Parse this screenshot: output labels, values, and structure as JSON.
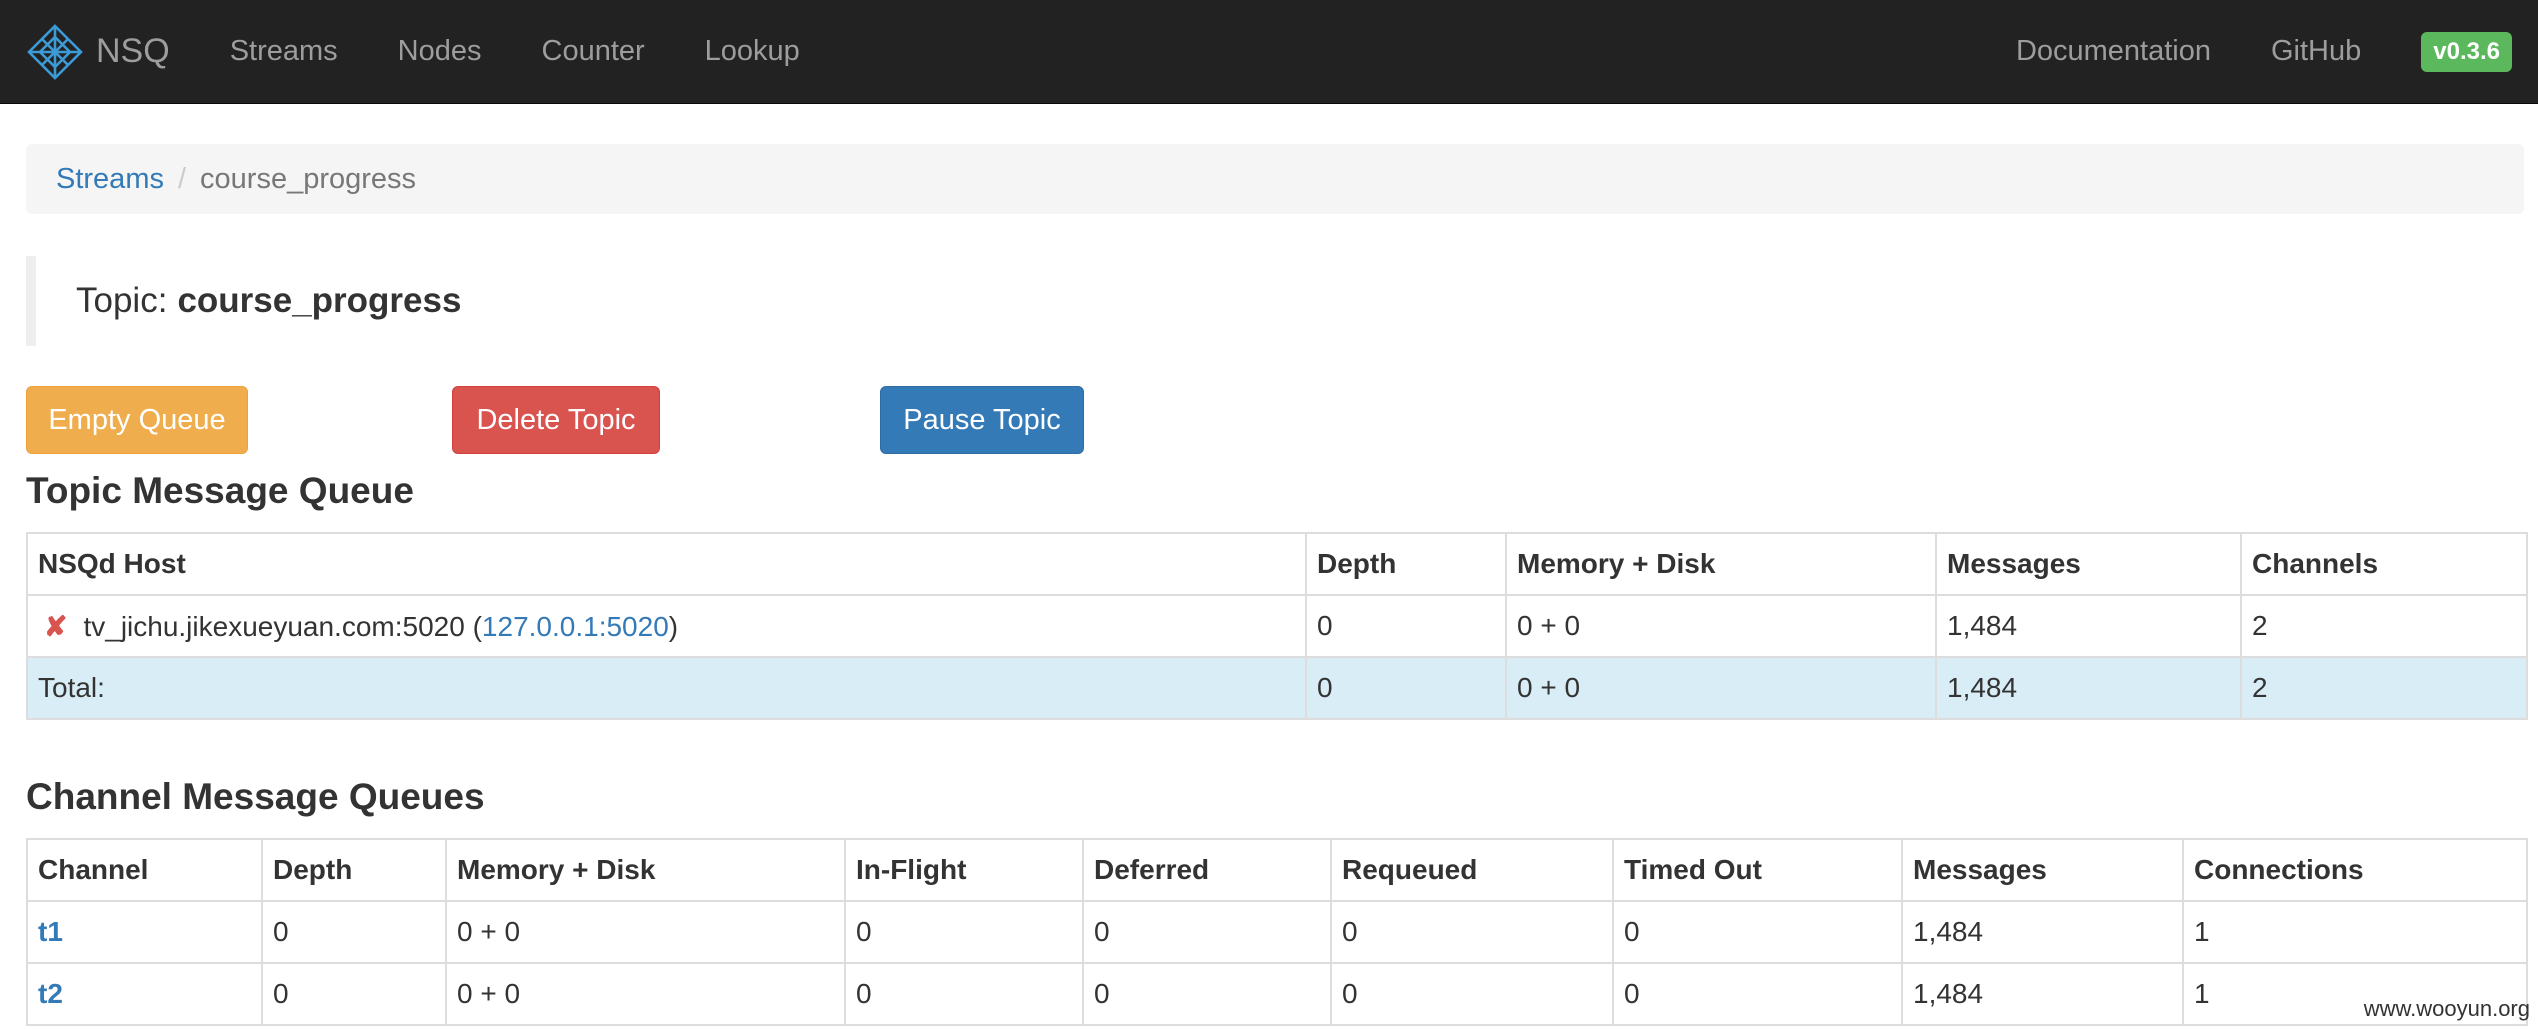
{
  "navbar": {
    "brand": "NSQ",
    "links": [
      "Streams",
      "Nodes",
      "Counter",
      "Lookup"
    ],
    "right_links": [
      "Documentation",
      "GitHub"
    ],
    "version": "v0.3.6"
  },
  "breadcrumb": {
    "parent": "Streams",
    "separator": "/",
    "current": "course_progress"
  },
  "topic": {
    "label": "Topic:",
    "name": "course_progress"
  },
  "actions": {
    "empty_queue": "Empty Queue",
    "delete_topic": "Delete Topic",
    "pause_topic": "Pause Topic"
  },
  "topic_queue": {
    "title": "Topic Message Queue",
    "headers": [
      "NSQd Host",
      "Depth",
      "Memory + Disk",
      "Messages",
      "Channels"
    ],
    "host_row": {
      "status_icon": "✘",
      "host": "tv_jichu.jikexueyuan.com:5020",
      "open_paren": "(",
      "address": "127.0.0.1:5020",
      "close_paren": ")",
      "depth": "0",
      "memory_disk": "0 + 0",
      "messages": "1,484",
      "channels": "2"
    },
    "total_row": {
      "label": "Total:",
      "depth": "0",
      "memory_disk": "0 + 0",
      "messages": "1,484",
      "channels": "2"
    }
  },
  "channel_queues": {
    "title": "Channel Message Queues",
    "headers": [
      "Channel",
      "Depth",
      "Memory + Disk",
      "In-Flight",
      "Deferred",
      "Requeued",
      "Timed Out",
      "Messages",
      "Connections"
    ],
    "rows": [
      {
        "channel": "t1",
        "depth": "0",
        "memory_disk": "0 + 0",
        "in_flight": "0",
        "deferred": "0",
        "requeued": "0",
        "timed_out": "0",
        "messages": "1,484",
        "connections": "1"
      },
      {
        "channel": "t2",
        "depth": "0",
        "memory_disk": "0 + 0",
        "in_flight": "0",
        "deferred": "0",
        "requeued": "0",
        "timed_out": "0",
        "messages": "1,484",
        "connections": "1"
      }
    ]
  },
  "watermark": "www.wooyun.org",
  "colors": {
    "navbar_bg": "#222222",
    "link": "#337ab7",
    "warning": "#f0ad4e",
    "danger": "#d9534f",
    "primary": "#337ab7",
    "version_badge": "#5cb85c",
    "total_row": "#d9edf7"
  },
  "icons": {
    "brand": "nsq-logo-icon",
    "host_status": "error-cross-icon"
  }
}
